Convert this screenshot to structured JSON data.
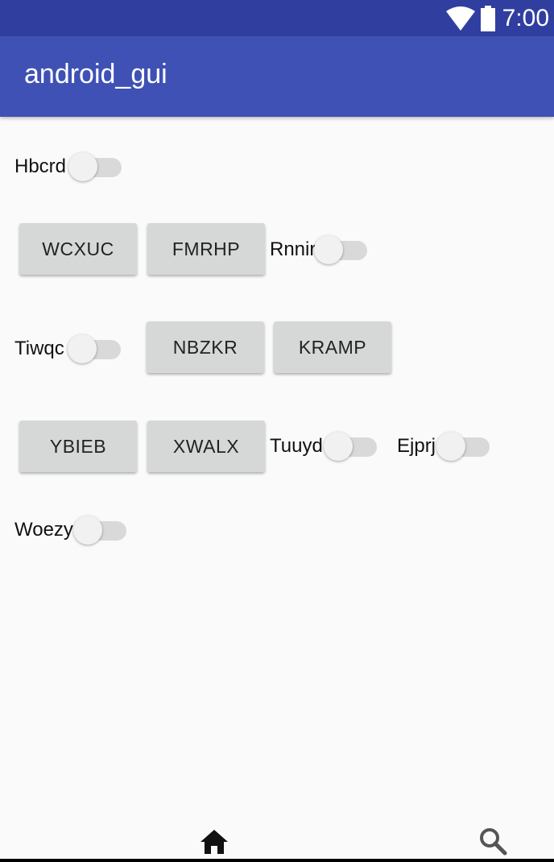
{
  "status_bar": {
    "time": "7:00",
    "icons": [
      "wifi-icon",
      "battery-icon"
    ]
  },
  "app_bar": {
    "title": "android_gui"
  },
  "rows": {
    "row1": {
      "switch_label": "Hbcrd",
      "switch_on": false
    },
    "row2": {
      "button1": "WCXUC",
      "button2": "FMRHP",
      "switch_label": "Rnnir",
      "switch_on": false
    },
    "row3": {
      "switch_label": "Tiwqc",
      "switch_on": false,
      "button1": "NBZKR",
      "button2": "KRAMP"
    },
    "row4": {
      "button1": "YBIEB",
      "button2": "XWALX",
      "switch1_label": "Tuuyd",
      "switch1_on": false,
      "switch2_label": "Ejprj",
      "switch2_on": false
    },
    "row5": {
      "switch_label": "Woezy",
      "switch_on": false
    }
  },
  "bottom_nav": {
    "items": [
      "home-icon",
      "search-icon"
    ]
  },
  "colors": {
    "status_bar": "#303f9f",
    "app_bar": "#3f51b5",
    "background": "#fafafa",
    "button": "#d6d7d7"
  }
}
